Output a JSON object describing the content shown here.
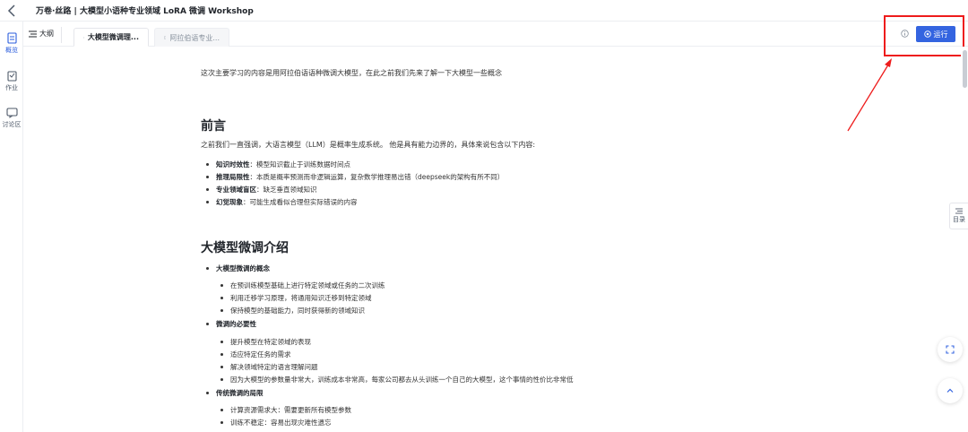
{
  "header": {
    "title": "万卷·丝路 | 大模型小语种专业领域 LoRA 微调 Workshop"
  },
  "leftrail": {
    "items": [
      {
        "label": "概览",
        "icon": "document-icon"
      },
      {
        "label": "作业",
        "icon": "assignment-icon"
      },
      {
        "label": "讨论区",
        "icon": "chat-icon"
      }
    ]
  },
  "tabbar": {
    "outline_label": "大纲",
    "tabs": [
      {
        "label": "大模型微调理...",
        "active": true
      },
      {
        "label": "阿拉伯语专业...",
        "active": false
      }
    ],
    "run_label": "运行"
  },
  "content": {
    "intro": "这次主要学习的内容是用阿拉伯语语种微调大模型，在此之前我们先来了解一下大模型一些概念",
    "section1": {
      "heading": "前言",
      "paragraph": "之前我们一直强调，大语言模型（LLM）是概率生成系统。 他是具有能力边界的，具体来说包含以下内容:",
      "bullets": [
        {
          "term": "知识时效性",
          "text": "：模型知识截止于训练数据时间点"
        },
        {
          "term": "推理局限性",
          "text": "：本质是概率预测而非逻辑运算，复杂数学推理易出错（deepseek的架构有所不同）"
        },
        {
          "term": "专业领域盲区",
          "text": "：缺乏垂直领域知识"
        },
        {
          "term": "幻觉现象",
          "text": "：可能生成看似合理但实际错误的内容"
        }
      ]
    },
    "section2": {
      "heading": "大模型微调介绍",
      "groups": [
        {
          "title": "大模型微调的概念",
          "items": [
            "在预训练模型基础上进行特定领域或任务的二次训练",
            "利用迁移学习原理，将通用知识迁移到特定领域",
            "保持模型的基础能力，同时获得新的领域知识"
          ]
        },
        {
          "title": "微调的必要性",
          "items": [
            "提升模型在特定领域的表现",
            "适应特定任务的需求",
            "解决领域特定的语言理解问题",
            "因为大模型的参数量非常大，训练成本非常高，每家公司都去从头训练一个自己的大模型，这个事情的性价比非常低"
          ]
        },
        {
          "title": "传统微调的局限",
          "items": [
            "计算资源需求大：需要更新所有模型参数",
            "训练不稳定：容易出现灾难性遗忘"
          ]
        }
      ]
    }
  },
  "right": {
    "toc_label": "目录"
  },
  "colors": {
    "accent": "#3464e0",
    "annotation": "#ee1c1c"
  }
}
